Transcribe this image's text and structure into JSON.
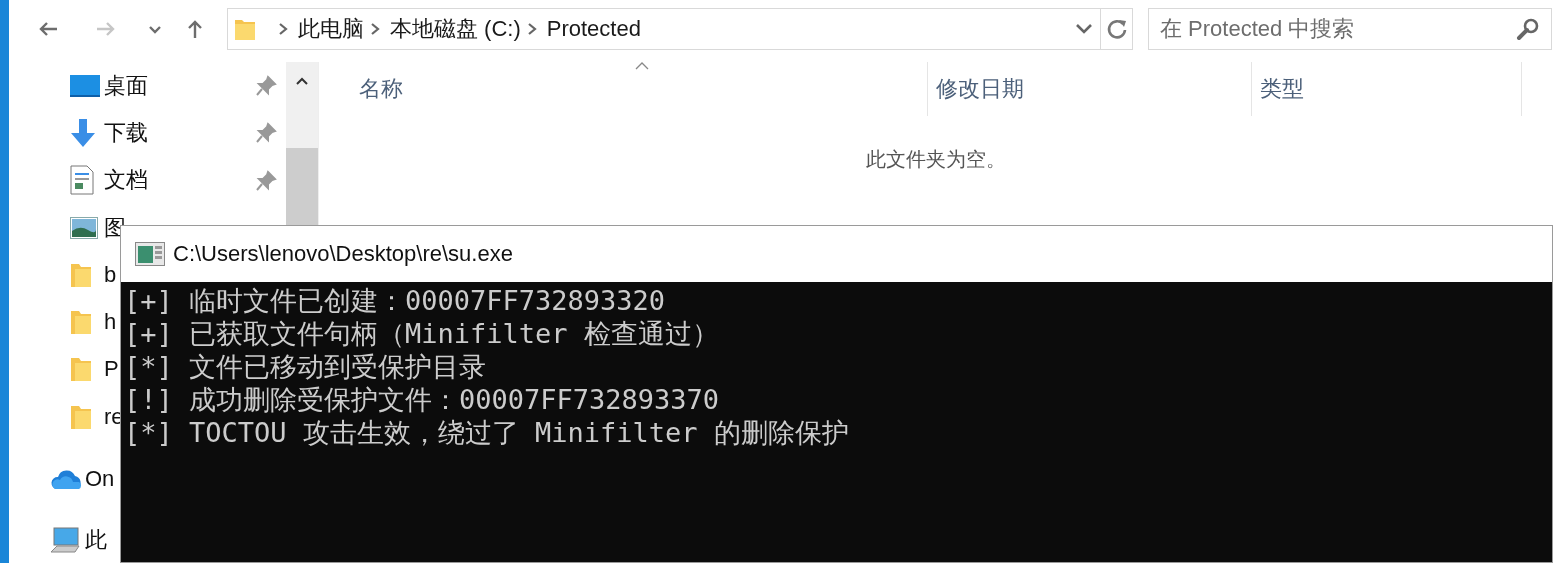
{
  "explorer": {
    "nav_buttons": [
      {
        "kind": "back",
        "disabled": false
      },
      {
        "kind": "forward",
        "disabled": true
      },
      {
        "kind": "recent",
        "disabled": false
      },
      {
        "kind": "up",
        "disabled": false
      }
    ],
    "breadcrumb": [
      "此电脑",
      "本地磁盘 (C:)",
      "Protected"
    ],
    "search": {
      "placeholder": "在 Protected 中搜索"
    },
    "sidebar": {
      "items": [
        {
          "label": "桌面",
          "kind": "desktop",
          "pinned": true
        },
        {
          "label": "下载",
          "kind": "download",
          "pinned": true
        },
        {
          "label": "文档",
          "kind": "document",
          "pinned": true
        },
        {
          "label": "图",
          "kind": "picture",
          "pinned": false
        },
        {
          "label": "b",
          "kind": "folder",
          "pinned": false
        },
        {
          "label": "h",
          "kind": "folder",
          "pinned": false
        },
        {
          "label": "P",
          "kind": "folder",
          "pinned": false
        },
        {
          "label": "re",
          "kind": "folder",
          "pinned": false
        },
        {
          "label": "On",
          "kind": "cloud",
          "pinned": false
        },
        {
          "label": "此",
          "kind": "computer",
          "pinned": false
        }
      ]
    },
    "columns": [
      {
        "label": "名称",
        "sorted": true
      },
      {
        "label": "修改日期",
        "sorted": false
      },
      {
        "label": "类型",
        "sorted": false
      }
    ],
    "empty_message": "此文件夹为空。"
  },
  "console": {
    "title": "C:\\Users\\lenovo\\Desktop\\re\\su.exe",
    "lines": [
      "[+] 临时文件已创建：00007FF732893320",
      "[+] 已获取文件句柄（Minifilter 检查通过）",
      "[*] 文件已移动到受保护目录",
      "[!] 成功删除受保护文件：00007FF732893370",
      "[*] TOCTOU 攻击生效，绕过了 Minifilter 的删除保护"
    ]
  }
}
